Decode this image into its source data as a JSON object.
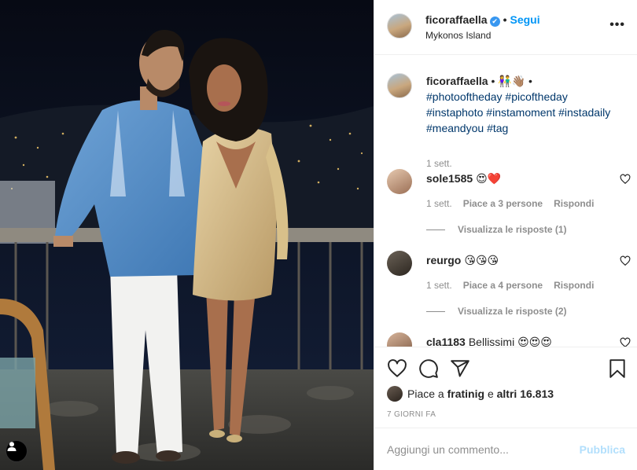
{
  "post": {
    "username": "ficoraffaella",
    "verified_mark": "✔",
    "separator": "•",
    "follow_label": "Segui",
    "location": "Mykonos Island",
    "more_label": "•••"
  },
  "caption": {
    "username": "ficoraffaella",
    "emojis": "• 👫👋🏽 •",
    "hashtags": [
      "#photooftheday",
      "#picoftheday",
      "#instaphoto",
      "#instamoment",
      "#instadaily",
      "#meandyou",
      "#tag"
    ],
    "time": "1 sett."
  },
  "comments": [
    {
      "username": "sole1585",
      "text": "😍❤️",
      "time": "1 sett.",
      "likes": "Piace a 3 persone",
      "reply_label": "Rispondi",
      "view_replies": "Visualizza le risposte (1)"
    },
    {
      "username": "reurgo",
      "text": "😘😘😘",
      "time": "1 sett.",
      "likes": "Piace a 4 persone",
      "reply_label": "Rispondi",
      "view_replies": "Visualizza le risposte (2)"
    },
    {
      "username": "cla1183",
      "text": "Bellissimi 😍😍😍"
    }
  ],
  "actions": {
    "like_icon": "heart-icon",
    "comment_icon": "comment-icon",
    "share_icon": "share-icon",
    "save_icon": "bookmark-icon"
  },
  "likes": {
    "prefix": "Piace a",
    "user": "fratinig",
    "middle": "e",
    "others": "altri 16.813"
  },
  "post_time": "7 GIORNI FA",
  "comment_form": {
    "placeholder": "Aggiungi un commento...",
    "publish_label": "Pubblica"
  },
  "colors": {
    "link_blue": "#0095f6",
    "hashtag": "#00376b",
    "muted": "#8e8e8e",
    "publish_disabled": "#b2dffc"
  }
}
